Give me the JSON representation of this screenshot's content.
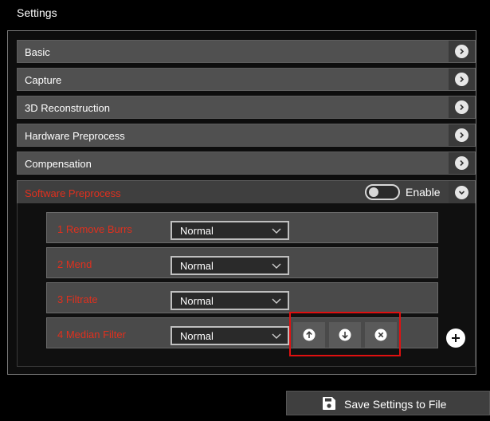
{
  "window": {
    "title": "Settings"
  },
  "sections": [
    {
      "label": "Basic",
      "expander_icon": "chevron-right-icon"
    },
    {
      "label": "Capture",
      "expander_icon": "chevron-right-icon"
    },
    {
      "label": "3D Reconstruction",
      "expander_icon": "chevron-right-icon"
    },
    {
      "label": "Hardware Preprocess",
      "expander_icon": "chevron-right-icon"
    },
    {
      "label": "Compensation",
      "expander_icon": "chevron-right-icon"
    }
  ],
  "software_preprocess": {
    "label": "Software Preprocess",
    "enable_label": "Enable",
    "enabled": false,
    "expander_icon": "chevron-down-icon",
    "label_color": "#e0301e",
    "steps": [
      {
        "label": "1  Remove Burrs",
        "mode": "Normal"
      },
      {
        "label": "2  Mend",
        "mode": "Normal"
      },
      {
        "label": "3  Filtrate",
        "mode": "Normal"
      },
      {
        "label": "4  Median Filter",
        "mode": "Normal"
      }
    ],
    "step_actions": [
      "move-up-icon",
      "move-down-icon",
      "remove-icon"
    ],
    "add_icon": "plus-icon",
    "highlight_color": "#e01010"
  },
  "footer": {
    "save_label": "Save Settings to File",
    "save_icon": "floppy-disk-icon"
  }
}
